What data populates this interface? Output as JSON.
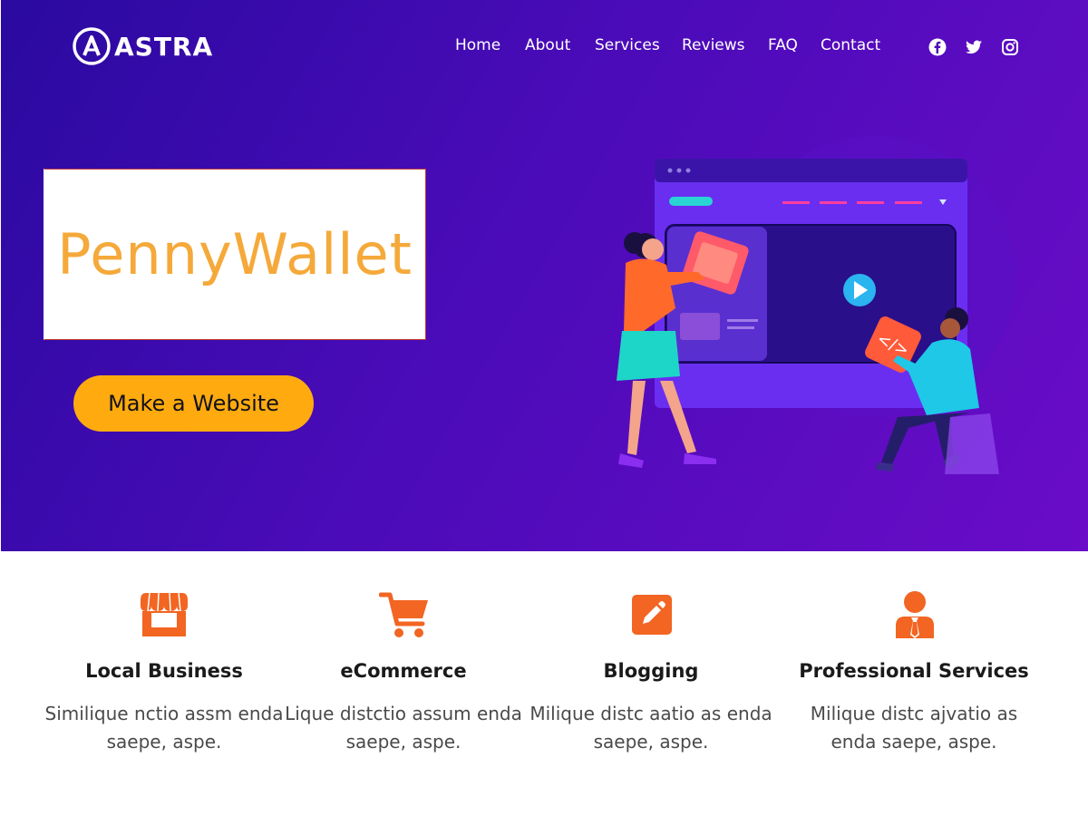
{
  "header": {
    "logo_text": "ASTRA",
    "nav": [
      "Home",
      "About",
      "Services",
      "Reviews",
      "FAQ",
      "Contact"
    ],
    "social_icons": [
      "facebook-icon",
      "twitter-icon",
      "instagram-icon"
    ]
  },
  "hero": {
    "brand_name": "PennyWallet",
    "cta_label": "Make a Website",
    "colors": {
      "gradient_start": "#2a0aa0",
      "gradient_end": "#6a0cc8",
      "cta": "#ffab0f",
      "brand_text": "#f5a93a"
    }
  },
  "features": [
    {
      "icon": "store-icon",
      "title": "Local Business",
      "text": "Similique nctio assm enda saepe, aspe."
    },
    {
      "icon": "cart-icon",
      "title": "eCommerce",
      "text": "Lique distctio assum enda saepe, aspe."
    },
    {
      "icon": "edit-icon",
      "title": "Blogging",
      "text": "Milique distc aatio as enda saepe, aspe."
    },
    {
      "icon": "professional-icon",
      "title": "Professional Services",
      "text": "Milique distc ajvatio as enda saepe, aspe."
    }
  ],
  "accent_color": "#f26522"
}
